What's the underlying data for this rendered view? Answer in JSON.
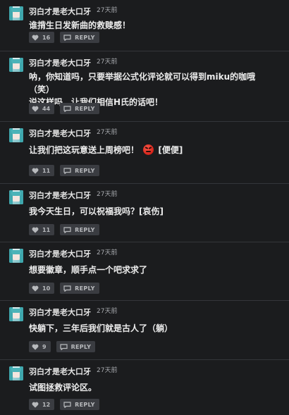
{
  "reply_label": "REPLY",
  "comments": [
    {
      "author": "羽白才是老大口牙",
      "time": "27天前",
      "text": "谁揹生日发新曲的救赎感！",
      "likes": "16",
      "emoji": ""
    },
    {
      "author": "羽白才是老大口牙",
      "time": "27天前",
      "text": "呐，你知道吗，只要举据公式化评论就可以得到miku的咖哦（笑）\n说这样吗，让我们相信H氏的话吧！",
      "likes": "44",
      "emoji": ""
    },
    {
      "author": "羽白才是老大口牙",
      "time": "27天前",
      "text_before": "让我们把这玩意送上周榜吧！",
      "text_after": "[便便]",
      "likes": "11",
      "emoji": "angry-face-icon"
    },
    {
      "author": "羽白才是老大口牙",
      "time": "27天前",
      "text": "我今天生日，可以祝福我吗？[哀伤]",
      "likes": "11",
      "emoji": ""
    },
    {
      "author": "羽白才是老大口牙",
      "time": "27天前",
      "text": "想要徽章，顺手点一个吧求求了",
      "likes": "10",
      "emoji": ""
    },
    {
      "author": "羽白才是老大口牙",
      "time": "27天前",
      "text": "快躺下，三年后我们就是古人了（躺）",
      "likes": "9",
      "emoji": ""
    },
    {
      "author": "羽白才是老大口牙",
      "time": "27天前",
      "text": "试图拯救评论区。",
      "likes": "12",
      "emoji": ""
    }
  ]
}
